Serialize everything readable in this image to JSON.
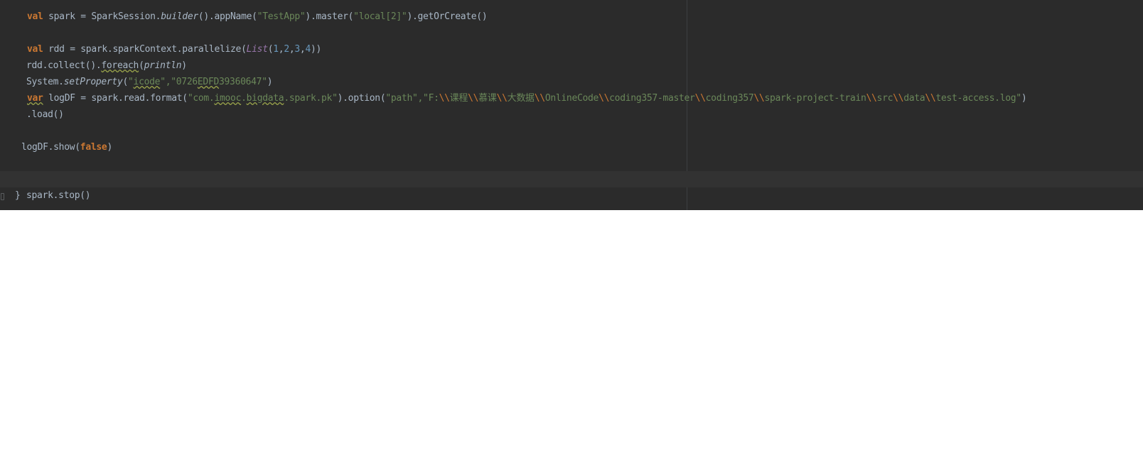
{
  "editor": {
    "lines": [
      {
        "kind": "code",
        "tokens": [
          {
            "t": "val",
            "c": "kw"
          },
          {
            "t": " spark = SparkSession."
          },
          {
            "t": "builder",
            "c": "it"
          },
          {
            "t": "().appName("
          },
          {
            "t": "\"TestApp\"",
            "c": "str"
          },
          {
            "t": ").master("
          },
          {
            "t": "\"local[2]\"",
            "c": "str"
          },
          {
            "t": ").getOrCreate()"
          }
        ]
      },
      {
        "kind": "code",
        "tokens": [
          {
            "t": "val",
            "c": "kw"
          },
          {
            "t": " rdd = spark.sparkContext.parallelize("
          },
          {
            "t": "List",
            "c": "typ"
          },
          {
            "t": "("
          },
          {
            "t": "1",
            "c": "num"
          },
          {
            "t": ","
          },
          {
            "t": "2",
            "c": "num"
          },
          {
            "t": ","
          },
          {
            "t": "3",
            "c": "num"
          },
          {
            "t": ","
          },
          {
            "t": "4",
            "c": "num"
          },
          {
            "t": "))"
          }
        ]
      },
      {
        "kind": "code",
        "tokens": [
          {
            "t": "rdd.collect()."
          },
          {
            "t": "foreach",
            "c": "ul"
          },
          {
            "t": "("
          },
          {
            "t": "println",
            "c": "it"
          },
          {
            "t": ")"
          }
        ]
      },
      {
        "kind": "code",
        "tokens": [
          {
            "t": "System."
          },
          {
            "t": "setProperty",
            "c": "it"
          },
          {
            "t": "("
          },
          {
            "t": "\"",
            "c": "str"
          },
          {
            "t": "icode",
            "c": "str ul"
          },
          {
            "t": "\",",
            "c": "str"
          },
          {
            "t": "\"0726",
            "c": "str"
          },
          {
            "t": "EDFD",
            "c": "str ul"
          },
          {
            "t": "39360647\"",
            "c": "str"
          },
          {
            "t": ")"
          }
        ]
      },
      {
        "kind": "code",
        "tokens": [
          {
            "t": "var",
            "c": "kw ul"
          },
          {
            "t": " logDF = spark.read.format("
          },
          {
            "t": "\"com.",
            "c": "str"
          },
          {
            "t": "imooc",
            "c": "str ul"
          },
          {
            "t": ".",
            "c": "str"
          },
          {
            "t": "bigdata",
            "c": "str ul"
          },
          {
            "t": ".spark.pk\"",
            "c": "str"
          },
          {
            "t": ").option("
          },
          {
            "t": "\"path\",",
            "c": "str"
          },
          {
            "t": "\"F:",
            "c": "str"
          },
          {
            "t": "\\\\",
            "c": "esc"
          },
          {
            "t": "课程",
            "c": "str"
          },
          {
            "t": "\\\\",
            "c": "esc"
          },
          {
            "t": "慕课",
            "c": "str"
          },
          {
            "t": "\\\\",
            "c": "esc"
          },
          {
            "t": "大数据",
            "c": "str"
          },
          {
            "t": "\\\\",
            "c": "esc"
          },
          {
            "t": "OnlineCode",
            "c": "str"
          },
          {
            "t": "\\\\",
            "c": "esc"
          },
          {
            "t": "coding357-master",
            "c": "str"
          },
          {
            "t": "\\\\",
            "c": "esc"
          },
          {
            "t": "coding357",
            "c": "str"
          },
          {
            "t": "\\\\",
            "c": "esc"
          },
          {
            "t": "spark-project-train",
            "c": "str"
          },
          {
            "t": "\\\\",
            "c": "esc"
          },
          {
            "t": "src",
            "c": "str"
          },
          {
            "t": "\\\\",
            "c": "esc"
          },
          {
            "t": "data",
            "c": "str"
          },
          {
            "t": "\\\\",
            "c": "esc"
          },
          {
            "t": "test-access.log\"",
            "c": "str"
          },
          {
            "t": ")"
          }
        ]
      },
      {
        "kind": "code",
        "tokens": [
          {
            "t": ".load()"
          }
        ]
      },
      {
        "kind": "code",
        "tokens": [
          {
            "t": "logDF.show("
          },
          {
            "t": "false",
            "c": "kw"
          },
          {
            "t": ")"
          }
        ]
      },
      {
        "kind": "code",
        "tokens": [
          {
            "t": "spark.stop()"
          }
        ]
      },
      {
        "kind": "code",
        "tokens": [
          {
            "t": "}"
          }
        ]
      }
    ]
  }
}
